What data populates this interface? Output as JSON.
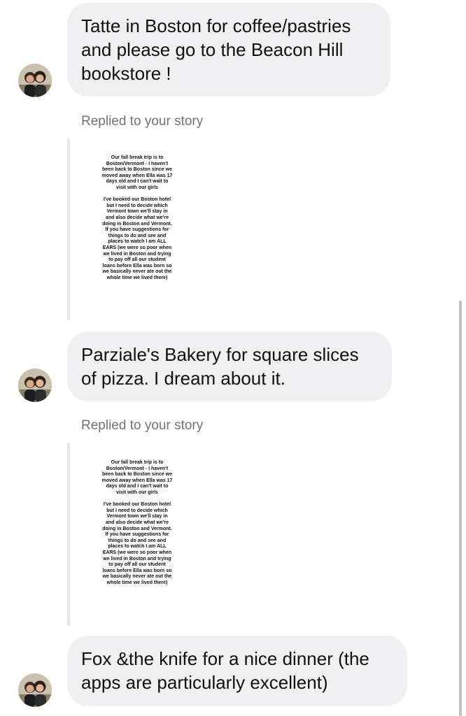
{
  "messages": [
    {
      "text": "Tatte in Boston for coffee/pastries\nand please go to the Beacon Hill\nbookstore !"
    },
    {
      "text": "Parziale's Bakery for square slices\nof pizza. I dream about it."
    },
    {
      "text": "Fox &the knife for a nice dinner (the\napps are particularly excellent)"
    }
  ],
  "replies": [
    {
      "label": "Replied to your story",
      "story_text": "Our fall break trip is to\nBoston/Vermont - I haven't\nbeen back to Boston since we\nmoved away when Ella was 17\ndays old and I can't wait to\nvisit with our girls\n\nI've booked our Boston hotel\nbut I need to decide which\nVermont town we'll stay in\nand also decide what we're\ndoing in Boston and Vermont.\nIf you have suggestions for\nthings to do and see and\nplaces to watch I am ALL\nEARS (we were so poor when\nwe lived in Boston and trying\nto pay off all our student\nloans before Ella was born so\nwe basically never ate out the\nwhole time we lived there)"
    },
    {
      "label": "Replied to your story",
      "story_text": "Our fall break trip is to\nBoston/Vermont - I haven't\nbeen back to Boston since we\nmoved away when Ella was 17\ndays old and I can't wait to\nvisit with our girls\n\nI've booked our Boston hotel\nbut I need to decide which\nVermont town we'll stay in\nand also decide what we're\ndoing in Boston and Vermont.\nIf you have suggestions for\nthings to do and see and\nplaces to watch I am ALL\nEARS (we were so poor when\nwe lived in Boston and trying\nto pay off all our student\nloans before Ella was born so\nwe basically never ate out the\nwhole time we lived there)"
    }
  ],
  "colors": {
    "bubble_bg": "#f0f0f2",
    "reply_label": "#737373",
    "text": "#111111"
  }
}
